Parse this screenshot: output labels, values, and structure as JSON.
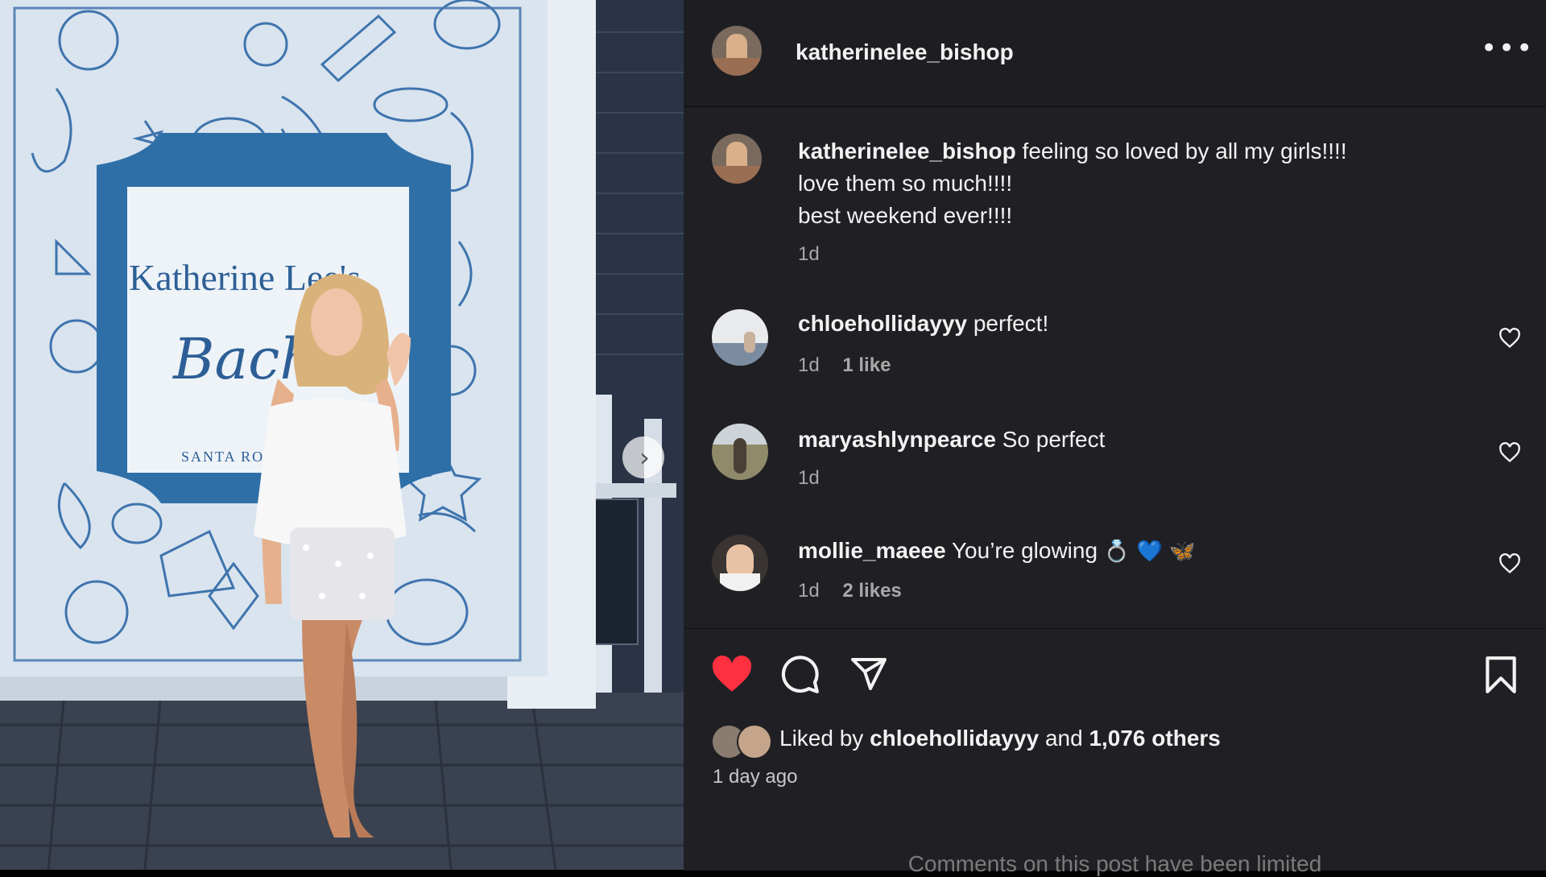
{
  "post": {
    "author": "katherinelee_bishop",
    "caption_lines": [
      "feeling so loved by all my girls!!!!",
      "love them so much!!!!",
      "best weekend ever!!!!"
    ],
    "caption_time": "1d",
    "banner_text": "Katherine Lee's",
    "banner_script": "Bach",
    "banner_location": "SANTA RO"
  },
  "comments": [
    {
      "user": "chloehollidayyy",
      "text": "perfect!",
      "time": "1d",
      "likes": "1 like"
    },
    {
      "user": "maryashlynpearce",
      "text": "So perfect",
      "time": "1d",
      "likes": ""
    },
    {
      "user": "mollie_maeee",
      "text": "You’re glowing",
      "emojis": "💍 💙 🦋",
      "time": "1d",
      "likes": "2 likes"
    }
  ],
  "footer": {
    "liked_prefix": "Liked by",
    "liked_user": "chloehollidayyy",
    "liked_and": "and",
    "liked_others": "1,076 others",
    "posted_ago": "1 day ago",
    "limited_notice": "Comments on this post have been limited"
  },
  "colors": {
    "panel_bg": "#202024",
    "like_red": "#ff3040",
    "banner_blue": "#2f6fa8"
  },
  "icons": [
    "more-icon",
    "heart-icon",
    "comment-icon",
    "share-icon",
    "bookmark-icon",
    "chevron-right-icon"
  ]
}
